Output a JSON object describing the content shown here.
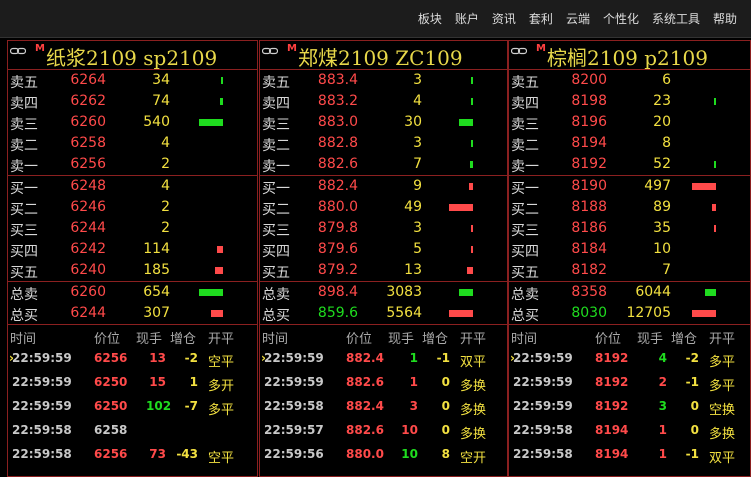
{
  "menu": [
    "板块",
    "账户",
    "资讯",
    "套利",
    "云端",
    "个性化",
    "系统工具",
    "帮助"
  ],
  "colors": {
    "red": "#ff4a4a",
    "green": "#1fdc1f",
    "yellow": "#f2e040",
    "border": "#8b2020"
  },
  "panels": [
    {
      "badge": "M",
      "title": "纸浆2109  sp2109",
      "sells": [
        {
          "label": "卖五",
          "price": "6264",
          "vol": "34",
          "bar": {
            "c": "green",
            "w": 2
          }
        },
        {
          "label": "卖四",
          "price": "6262",
          "vol": "74",
          "bar": {
            "c": "green",
            "w": 3
          }
        },
        {
          "label": "卖三",
          "price": "6260",
          "vol": "540",
          "bar": {
            "c": "green",
            "w": 24
          }
        },
        {
          "label": "卖二",
          "price": "6258",
          "vol": "4",
          "bar": null
        },
        {
          "label": "卖一",
          "price": "6256",
          "vol": "2",
          "bar": null
        }
      ],
      "buys": [
        {
          "label": "买一",
          "price": "6248",
          "vol": "4",
          "bar": null
        },
        {
          "label": "买二",
          "price": "6246",
          "vol": "2",
          "bar": null
        },
        {
          "label": "买三",
          "price": "6244",
          "vol": "2",
          "bar": null
        },
        {
          "label": "买四",
          "price": "6242",
          "vol": "114",
          "bar": {
            "c": "red",
            "w": 6
          }
        },
        {
          "label": "买五",
          "price": "6240",
          "vol": "185",
          "bar": {
            "c": "red",
            "w": 8
          }
        }
      ],
      "totals": [
        {
          "label": "总卖",
          "price": "6260",
          "pc": "red",
          "vol": "654",
          "bar": {
            "c": "green",
            "w": 24
          }
        },
        {
          "label": "总买",
          "price": "6244",
          "pc": "red",
          "vol": "307",
          "bar": {
            "c": "red",
            "w": 12
          }
        }
      ],
      "trades": [
        {
          "time": "22:59:59",
          "price": "6256",
          "pc": "red",
          "qty": "13",
          "qc": "red",
          "chg": "-2",
          "cc": "yellow",
          "type": "空平",
          "tc": "yellow",
          "arrow": true
        },
        {
          "time": "22:59:59",
          "price": "6250",
          "pc": "red",
          "qty": "15",
          "qc": "red",
          "chg": "1",
          "cc": "yellow",
          "type": "多开",
          "tc": "yellow",
          "arrow": false
        },
        {
          "time": "22:59:59",
          "price": "6250",
          "pc": "red",
          "qty": "102",
          "qc": "green",
          "chg": "-7",
          "cc": "yellow",
          "type": "多平",
          "tc": "yellow",
          "arrow": false
        },
        {
          "time": "22:59:58",
          "price": "6258",
          "pc": "gray",
          "qty": "",
          "qc": "red",
          "chg": "",
          "cc": "yellow",
          "type": "",
          "tc": "yellow",
          "arrow": false
        },
        {
          "time": "22:59:58",
          "price": "6256",
          "pc": "red",
          "qty": "73",
          "qc": "red",
          "chg": "-43",
          "cc": "yellow",
          "type": "空平",
          "tc": "yellow",
          "arrow": false
        }
      ]
    },
    {
      "badge": "M",
      "title": "郑煤2109  ZC109",
      "sells": [
        {
          "label": "卖五",
          "price": "883.4",
          "vol": "3",
          "bar": {
            "c": "green",
            "w": 2
          }
        },
        {
          "label": "卖四",
          "price": "883.2",
          "vol": "4",
          "bar": {
            "c": "green",
            "w": 2
          }
        },
        {
          "label": "卖三",
          "price": "883.0",
          "vol": "30",
          "bar": {
            "c": "green",
            "w": 14
          }
        },
        {
          "label": "卖二",
          "price": "882.8",
          "vol": "3",
          "bar": {
            "c": "green",
            "w": 2
          }
        },
        {
          "label": "卖一",
          "price": "882.6",
          "vol": "7",
          "bar": {
            "c": "green",
            "w": 3
          }
        }
      ],
      "buys": [
        {
          "label": "买一",
          "price": "882.4",
          "vol": "9",
          "bar": {
            "c": "red",
            "w": 4
          }
        },
        {
          "label": "买二",
          "price": "880.0",
          "vol": "49",
          "bar": {
            "c": "red",
            "w": 24
          }
        },
        {
          "label": "买三",
          "price": "879.8",
          "vol": "3",
          "bar": {
            "c": "red",
            "w": 2
          }
        },
        {
          "label": "买四",
          "price": "879.6",
          "vol": "5",
          "bar": {
            "c": "red",
            "w": 2
          }
        },
        {
          "label": "买五",
          "price": "879.2",
          "vol": "13",
          "bar": {
            "c": "red",
            "w": 6
          }
        }
      ],
      "totals": [
        {
          "label": "总卖",
          "price": "898.4",
          "pc": "red",
          "vol": "3083",
          "bar": {
            "c": "green",
            "w": 14
          }
        },
        {
          "label": "总买",
          "price": "859.6",
          "pc": "green",
          "vol": "5564",
          "bar": {
            "c": "red",
            "w": 24
          }
        }
      ],
      "trades": [
        {
          "time": "22:59:59",
          "price": "882.4",
          "pc": "red",
          "qty": "1",
          "qc": "green",
          "chg": "-1",
          "cc": "yellow",
          "type": "双平",
          "tc": "yellow",
          "arrow": true
        },
        {
          "time": "22:59:59",
          "price": "882.6",
          "pc": "red",
          "qty": "1",
          "qc": "red",
          "chg": "0",
          "cc": "yellow",
          "type": "多换",
          "tc": "yellow",
          "arrow": false
        },
        {
          "time": "22:59:58",
          "price": "882.4",
          "pc": "red",
          "qty": "3",
          "qc": "red",
          "chg": "0",
          "cc": "yellow",
          "type": "多换",
          "tc": "yellow",
          "arrow": false
        },
        {
          "time": "22:59:57",
          "price": "882.6",
          "pc": "red",
          "qty": "10",
          "qc": "red",
          "chg": "0",
          "cc": "yellow",
          "type": "多换",
          "tc": "yellow",
          "arrow": false
        },
        {
          "time": "22:59:56",
          "price": "880.0",
          "pc": "red",
          "qty": "10",
          "qc": "green",
          "chg": "8",
          "cc": "yellow",
          "type": "空开",
          "tc": "yellow",
          "arrow": false
        }
      ]
    },
    {
      "badge": "M",
      "title": "棕榈2109  p2109",
      "sells": [
        {
          "label": "卖五",
          "price": "8200",
          "vol": "6",
          "bar": null
        },
        {
          "label": "卖四",
          "price": "8198",
          "vol": "23",
          "bar": {
            "c": "green",
            "w": 2
          }
        },
        {
          "label": "卖三",
          "price": "8196",
          "vol": "20",
          "bar": null
        },
        {
          "label": "卖二",
          "price": "8194",
          "vol": "8",
          "bar": null
        },
        {
          "label": "卖一",
          "price": "8192",
          "vol": "52",
          "bar": {
            "c": "green",
            "w": 2
          }
        }
      ],
      "buys": [
        {
          "label": "买一",
          "price": "8190",
          "vol": "497",
          "bar": {
            "c": "red",
            "w": 24
          }
        },
        {
          "label": "买二",
          "price": "8188",
          "vol": "89",
          "bar": {
            "c": "red",
            "w": 4
          }
        },
        {
          "label": "买三",
          "price": "8186",
          "vol": "35",
          "bar": {
            "c": "red",
            "w": 2
          }
        },
        {
          "label": "买四",
          "price": "8184",
          "vol": "10",
          "bar": null
        },
        {
          "label": "买五",
          "price": "8182",
          "vol": "7",
          "bar": null
        }
      ],
      "totals": [
        {
          "label": "总卖",
          "price": "8358",
          "pc": "red",
          "vol": "6044",
          "bar": {
            "c": "green",
            "w": 11
          }
        },
        {
          "label": "总买",
          "price": "8030",
          "pc": "green",
          "vol": "12705",
          "bar": {
            "c": "red",
            "w": 24
          }
        }
      ],
      "trades": [
        {
          "time": "22:59:59",
          "price": "8192",
          "pc": "red",
          "qty": "4",
          "qc": "green",
          "chg": "-2",
          "cc": "yellow",
          "type": "多平",
          "tc": "yellow",
          "arrow": true
        },
        {
          "time": "22:59:59",
          "price": "8192",
          "pc": "red",
          "qty": "2",
          "qc": "red",
          "chg": "-1",
          "cc": "yellow",
          "type": "多平",
          "tc": "yellow",
          "arrow": false
        },
        {
          "time": "22:59:59",
          "price": "8192",
          "pc": "red",
          "qty": "3",
          "qc": "green",
          "chg": "0",
          "cc": "yellow",
          "type": "空换",
          "tc": "yellow",
          "arrow": false
        },
        {
          "time": "22:59:58",
          "price": "8194",
          "pc": "red",
          "qty": "1",
          "qc": "red",
          "chg": "0",
          "cc": "yellow",
          "type": "多换",
          "tc": "yellow",
          "arrow": false
        },
        {
          "time": "22:59:58",
          "price": "8194",
          "pc": "red",
          "qty": "1",
          "qc": "red",
          "chg": "-1",
          "cc": "yellow",
          "type": "双平",
          "tc": "yellow",
          "arrow": false
        }
      ]
    }
  ],
  "trade_headers": [
    "时间",
    "价位",
    "现手",
    "增仓",
    "开平"
  ]
}
